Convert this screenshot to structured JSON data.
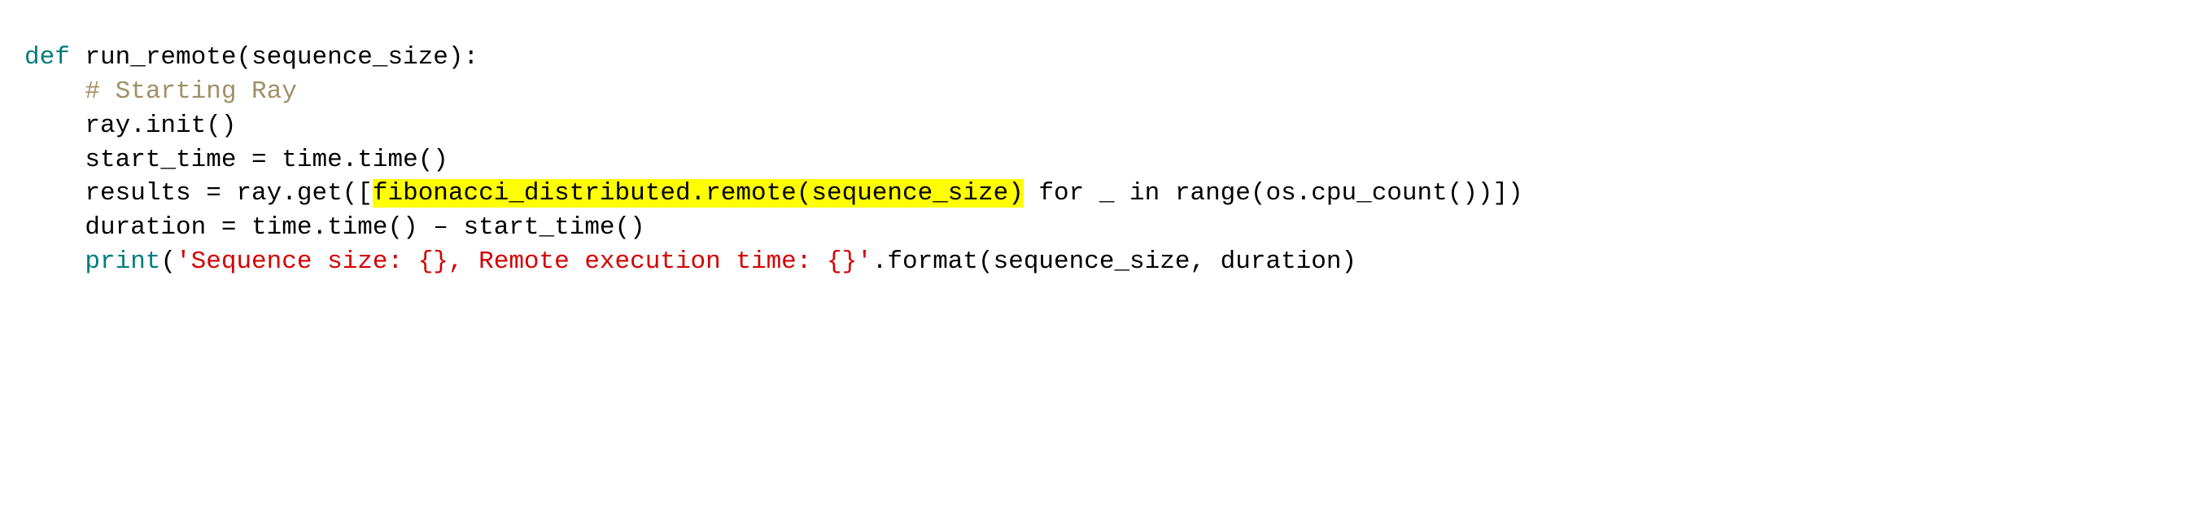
{
  "code": {
    "kw_def": "def",
    "fn_name": "run_remote",
    "param": "sequence_size",
    "paren_open": "(",
    "paren_close": ")",
    "colon": ":",
    "comment": "# Starting Ray",
    "l3": "ray.init()",
    "l4": "start_time = time.time()",
    "l5a": "results = ray.get([",
    "l5_hl": "fibonacci_distributed.remote(sequence_size)",
    "l5b": " for _ in range(os.cpu_count())])",
    "l6": "duration = time.time() – start_time()",
    "kw_print": "print",
    "l7_str": "'Sequence size: {}, Remote execution time: {}'",
    "l7b": ".format(sequence_size, duration)"
  }
}
